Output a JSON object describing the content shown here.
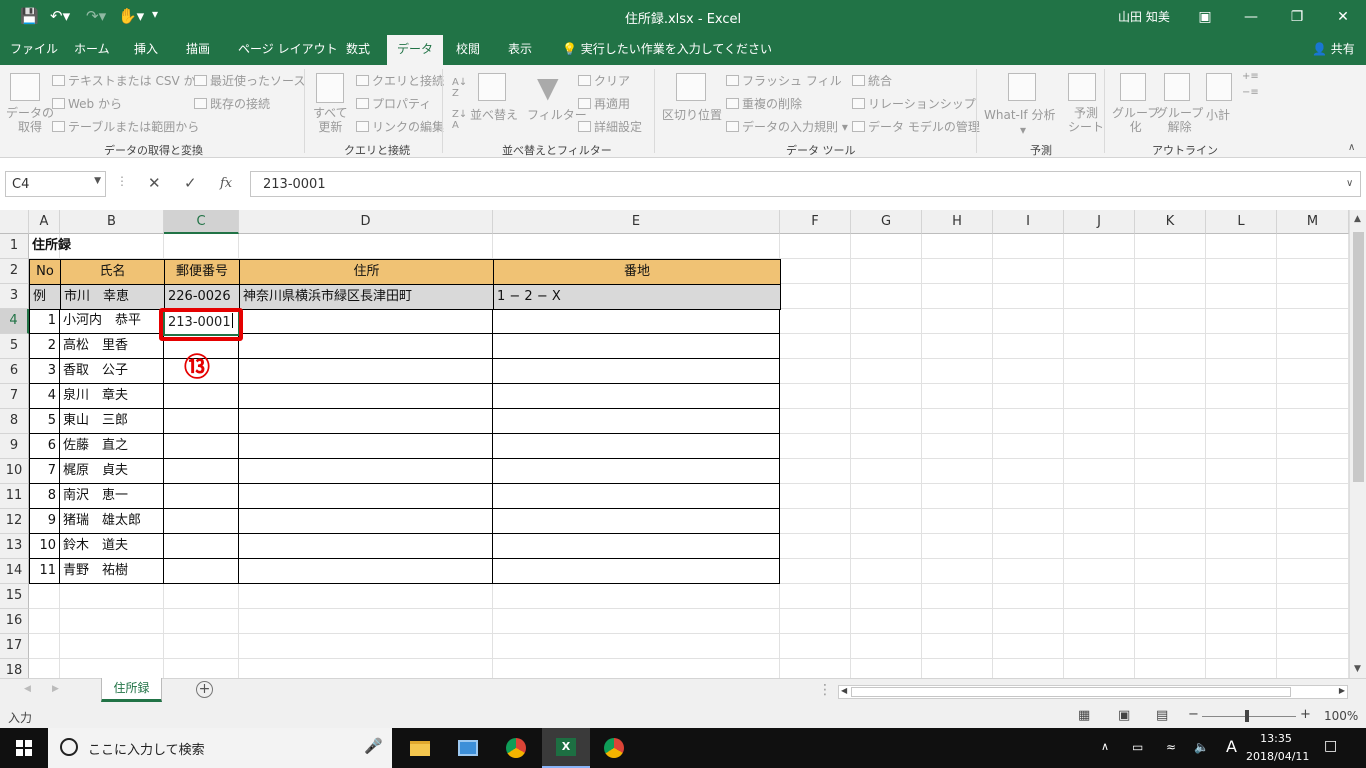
{
  "window": {
    "title": "住所録.xlsx  -  Excel",
    "user": "山田 知美"
  },
  "tabs": [
    "ファイル",
    "ホーム",
    "挿入",
    "描画",
    "ページ レイアウト",
    "数式",
    "データ",
    "校閲",
    "表示"
  ],
  "active_tab": "データ",
  "tell_me": "実行したい作業を入力してください",
  "share": "共有",
  "ribbon": {
    "get_data": "データの\n取得",
    "from_text_csv": "テキストまたは CSV から",
    "from_web": "Web から",
    "from_table": "テーブルまたは範囲から",
    "recent_sources": "最近使ったソース",
    "existing_connections": "既存の接続",
    "group_get_transform": "データの取得と変換",
    "refresh_all": "すべて\n更新",
    "queries_connections": "クエリと接続",
    "properties": "プロパティ",
    "edit_links": "リンクの編集",
    "group_queries": "クエリと接続",
    "sort": "並べ替え",
    "filter": "フィルター",
    "clear": "クリア",
    "reapply": "再適用",
    "advanced": "詳細設定",
    "group_sort_filter": "並べ替えとフィルター",
    "text_to_columns": "区切り位置",
    "flash_fill": "フラッシュ フィル",
    "remove_duplicates": "重複の削除",
    "data_validation": "データの入力規則",
    "consolidate": "統合",
    "relationships": "リレーションシップ",
    "data_model": "データ モデルの管理",
    "group_data_tools": "データ ツール",
    "what_if": "What-If 分析",
    "forecast_sheet": "予測\nシート",
    "group_forecast": "予測",
    "group": "グループ\n化",
    "ungroup": "グループ\n解除",
    "subtotal": "小計",
    "group_outline": "アウトライン"
  },
  "formula_bar": {
    "name_box": "C4",
    "formula": "213-0001"
  },
  "columns": [
    "A",
    "B",
    "C",
    "D",
    "E",
    "F",
    "G",
    "H",
    "I",
    "J",
    "K",
    "L",
    "M"
  ],
  "rows": [
    "1",
    "2",
    "3",
    "4",
    "5",
    "6",
    "7",
    "8",
    "9",
    "10",
    "11",
    "12",
    "13",
    "14",
    "15",
    "16",
    "17",
    "18"
  ],
  "sheet": {
    "title": "住所録",
    "headers": [
      "No",
      "氏名",
      "郵便番号",
      "住所",
      "番地"
    ],
    "example": [
      "例",
      "市川　幸恵",
      "226-0026",
      "神奈川県横浜市緑区長津田町",
      "1 − 2 − X"
    ],
    "entries": [
      {
        "no": "1",
        "name": "小河内　恭平"
      },
      {
        "no": "2",
        "name": "高松　里香"
      },
      {
        "no": "3",
        "name": "香取　公子"
      },
      {
        "no": "4",
        "name": "泉川　章夫"
      },
      {
        "no": "5",
        "name": "東山　三郎"
      },
      {
        "no": "6",
        "name": "佐藤　直之"
      },
      {
        "no": "7",
        "name": "梶原　貞夫"
      },
      {
        "no": "8",
        "name": "南沢　恵一"
      },
      {
        "no": "9",
        "name": "猪瑞　雄太郎"
      },
      {
        "no": "10",
        "name": "鈴木　道夫"
      },
      {
        "no": "11",
        "name": "青野　祐樹"
      }
    ],
    "active_value": "213-0001"
  },
  "callout": "⑬",
  "sheet_tab": "住所録",
  "status": {
    "mode": "入力",
    "zoom": "100%"
  },
  "taskbar": {
    "search": "ここに入力して検索",
    "time": "13:35",
    "date": "2018/04/11",
    "ime": "A"
  },
  "colors": {
    "excel_green": "#217346",
    "header_fill": "#f0c274",
    "example_fill": "#d9d9d9",
    "callout_red": "#e50000"
  }
}
